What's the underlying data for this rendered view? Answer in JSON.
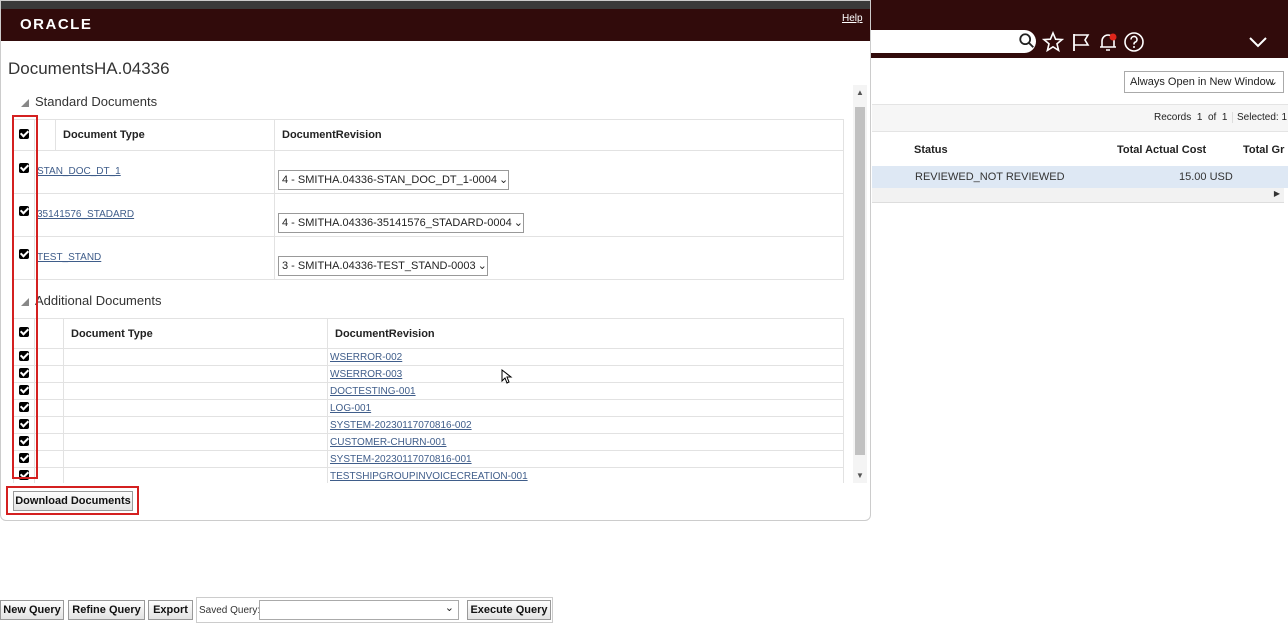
{
  "background": {
    "window_mode": "Always Open in New Window",
    "records_label": "Records",
    "records_from": "1",
    "records_of_label": "of",
    "records_total": "1",
    "selected_label": "Selected:",
    "selected_count": "1",
    "columns": [
      "Status",
      "Total Actual Cost",
      "Total Gr"
    ],
    "row": {
      "status": "REVIEWED_NOT REVIEWED",
      "total_actual_cost": "15.00 USD"
    },
    "icons": [
      "search-icon",
      "star-icon",
      "flag-icon",
      "bell-icon",
      "help-icon",
      "chevron-down-icon"
    ]
  },
  "modal": {
    "logo": "ORACLE",
    "help": "Help",
    "title": "DocumentsHA.04336",
    "standard": {
      "heading": "Standard Documents",
      "col_type": "Document Type",
      "col_revision": "DocumentRevision",
      "rows": [
        {
          "type": "STAN_DOC_DT_1",
          "revision": "4 - SMITHA.04336-STAN_DOC_DT_1-0004"
        },
        {
          "type": "35141576_STADARD",
          "revision": "4 - SMITHA.04336-35141576_STADARD-0004"
        },
        {
          "type": "TEST_STAND",
          "revision": "3 - SMITHA.04336-TEST_STAND-0003"
        }
      ]
    },
    "additional": {
      "heading": "Additional Documents",
      "col_type": "Document Type",
      "col_revision": "DocumentRevision",
      "rows": [
        "WSERROR-002",
        "WSERROR-003",
        "DOCTESTING-001",
        "LOG-001",
        "SYSTEM-20230117070816-002",
        "CUSTOMER-CHURN-001",
        "SYSTEM-20230117070816-001",
        "TESTSHIPGROUPINVOICECREATION-001"
      ]
    },
    "download_button": "Download Documents"
  },
  "bottom_bar": {
    "new_query": "New Query",
    "refine_query": "Refine Query",
    "export": "Export",
    "saved_query_label": "Saved Query:",
    "saved_query_value": "",
    "execute_query": "Execute Query"
  },
  "colors": {
    "header": "#310b0b",
    "highlight": "#d42020",
    "link": "#3f5d8a",
    "selected_row": "#dee8f4"
  }
}
